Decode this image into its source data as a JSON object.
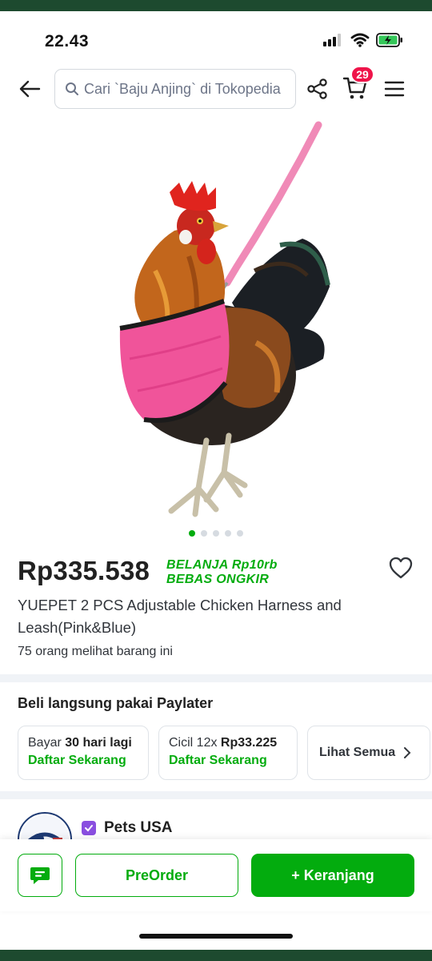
{
  "status_bar": {
    "time": "22.43"
  },
  "search": {
    "placeholder": "Cari `Baju Anjing` di Tokopedia"
  },
  "cart": {
    "badge_count": "29"
  },
  "product": {
    "price": "Rp335.538",
    "promo_line1": "BELANJA Rp10rb",
    "promo_line2": "BEBAS ONGKIR",
    "title": "YUEPET 2 PCS Adjustable Chicken Harness and Leash(Pink&Blue)",
    "viewers": "75 orang melihat barang ini",
    "image_count": 5,
    "active_image": 1
  },
  "paylater": {
    "title": "Beli langsung pakai Paylater",
    "options": [
      {
        "prefix": "Bayar ",
        "bold": "30 hari lagi",
        "action": "Daftar Sekarang"
      },
      {
        "prefix": "Cicil 12x ",
        "bold": "Rp33.225",
        "action": "Daftar Sekarang"
      }
    ],
    "see_all": "Lihat Semua"
  },
  "shop": {
    "name": "Pets USA"
  },
  "actions": {
    "preorder": "PreOrder",
    "add_to_cart": "+ Keranjang"
  },
  "colors": {
    "brand_green": "#03ac0e",
    "badge_red": "#ef144a",
    "frame": "#1d4a2f",
    "harness_pink": "#f0549a"
  },
  "icons": [
    "back-arrow-icon",
    "search-icon",
    "share-icon",
    "cart-icon",
    "menu-icon",
    "heart-icon",
    "chevron-right-icon",
    "chat-icon",
    "shop-badge-icon"
  ]
}
